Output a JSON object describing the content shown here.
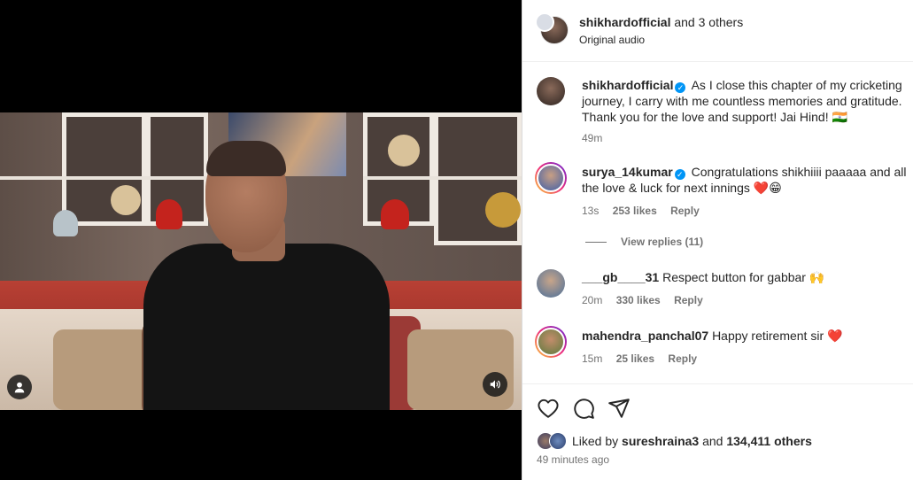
{
  "post": {
    "author": "shikhardofficial",
    "collab_suffix": "and 3 others",
    "audio": "Original audio",
    "caption_author": "shikhardofficial",
    "caption_text": "As I close this chapter of my cricketing journey, I carry with me countless memories and gratitude. Thank you for the love and support! Jai Hind! 🇮🇳",
    "caption_time": "49m"
  },
  "comments": [
    {
      "username": "surya_14kumar",
      "verified": true,
      "text": "Congratulations shikhiiii paaaaa and all the love & luck for next innings ❤️😁",
      "time": "13s",
      "likes": "253 likes",
      "reply": "Reply"
    },
    {
      "username": "___gb____31",
      "verified": false,
      "text": "Respect button for gabbar 🙌",
      "time": "20m",
      "likes": "330 likes",
      "reply": "Reply"
    },
    {
      "username": "mahendra_panchal07",
      "verified": false,
      "text": "Happy retirement sir ❤️",
      "time": "15m",
      "likes": "25 likes",
      "reply": "Reply"
    }
  ],
  "view_replies": "View replies (11)",
  "likes": {
    "prefix": "Liked by",
    "user": "sureshraina3",
    "connector": "and",
    "count": "134,411 others"
  },
  "timestamp": "49 minutes ago",
  "icons": {
    "like": "heart-icon",
    "comment": "comment-icon",
    "share": "share-icon",
    "user_tag": "user-icon",
    "audio": "speaker-icon"
  }
}
